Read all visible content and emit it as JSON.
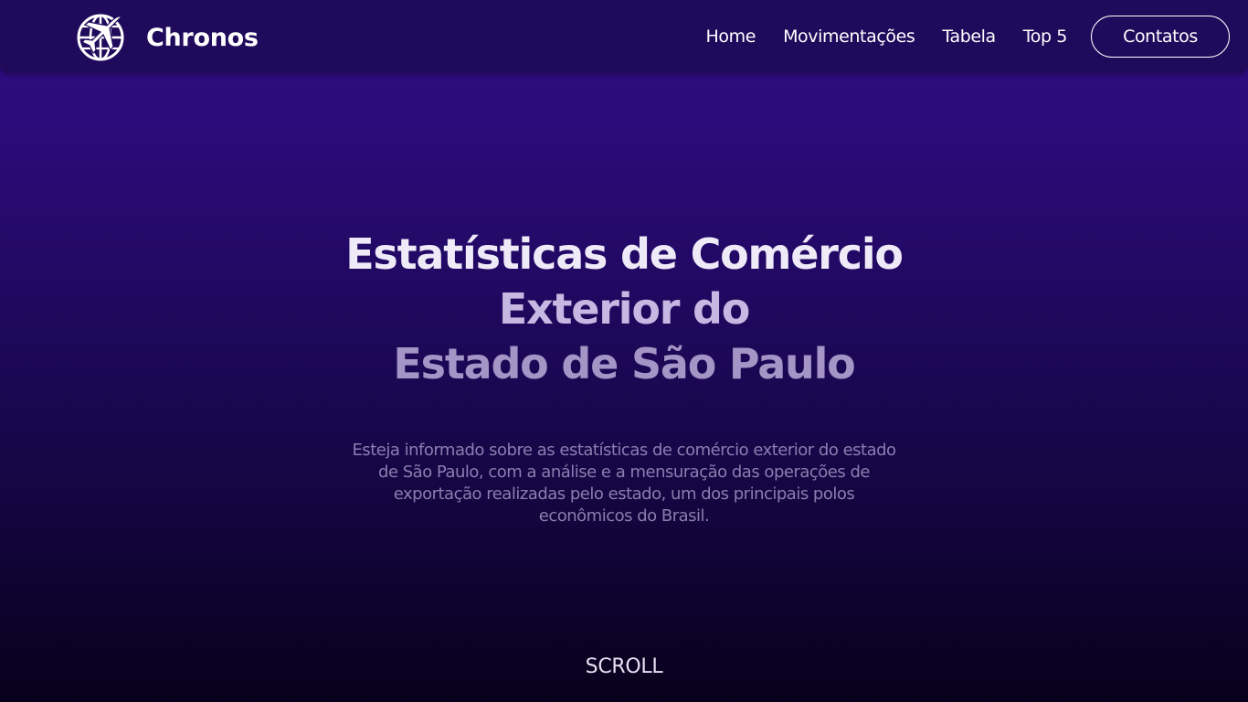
{
  "brand": {
    "name": "Chronos",
    "logo_icon": "globe-airplane-icon"
  },
  "nav": {
    "items": [
      {
        "label": "Home"
      },
      {
        "label": "Movimentações"
      },
      {
        "label": "Tabela"
      },
      {
        "label": "Top 5"
      }
    ],
    "cta_label": "Contatos"
  },
  "hero": {
    "title_lines": [
      "Estatísticas de Comércio",
      "Exterior do",
      "Estado de São Paulo"
    ],
    "description": "Esteja informado sobre as estatísticas de comércio exterior do estado de São Paulo, com a análise e a mensuração das operações de exportação realizadas pelo estado, um dos principais polos econômicos do Brasil."
  },
  "scroll_label": "SCROLL",
  "colors": {
    "navbar": "#200a5c",
    "background_top": "#310d86",
    "background_bottom": "#07011c",
    "text": "#ffffff"
  }
}
